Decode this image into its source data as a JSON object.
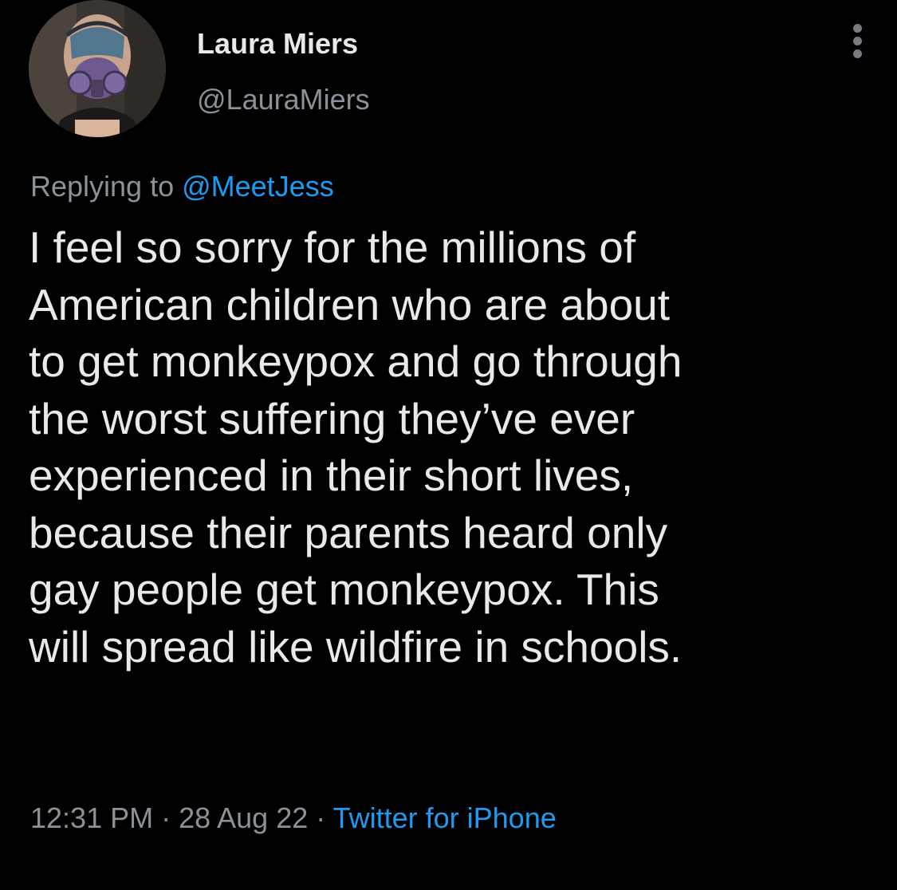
{
  "tweet": {
    "author": {
      "display_name": "Laura Miers",
      "handle": "@LauraMiers",
      "avatar_icon": "avatar-photo-gas-mask"
    },
    "more_icon": "more-options-icon",
    "reply": {
      "prefix": "Replying to ",
      "mention": "@MeetJess"
    },
    "text_lines": [
      "I feel so sorry for the millions of",
      "American children who are about",
      "to get monkeypox and go through",
      "the worst suffering they’ve ever",
      "experienced in their short lives,",
      "because their parents heard only",
      "gay people get monkeypox. This",
      "will spread like wildfire in schools."
    ],
    "meta": {
      "time": "12:31 PM",
      "sep1": " · ",
      "date": "28 Aug 22",
      "sep2": " · ",
      "source": "Twitter for iPhone"
    }
  },
  "colors": {
    "background": "#000000",
    "primary_text": "#e7e9ea",
    "secondary_text": "#8b9198",
    "link": "#1d9bf0"
  }
}
